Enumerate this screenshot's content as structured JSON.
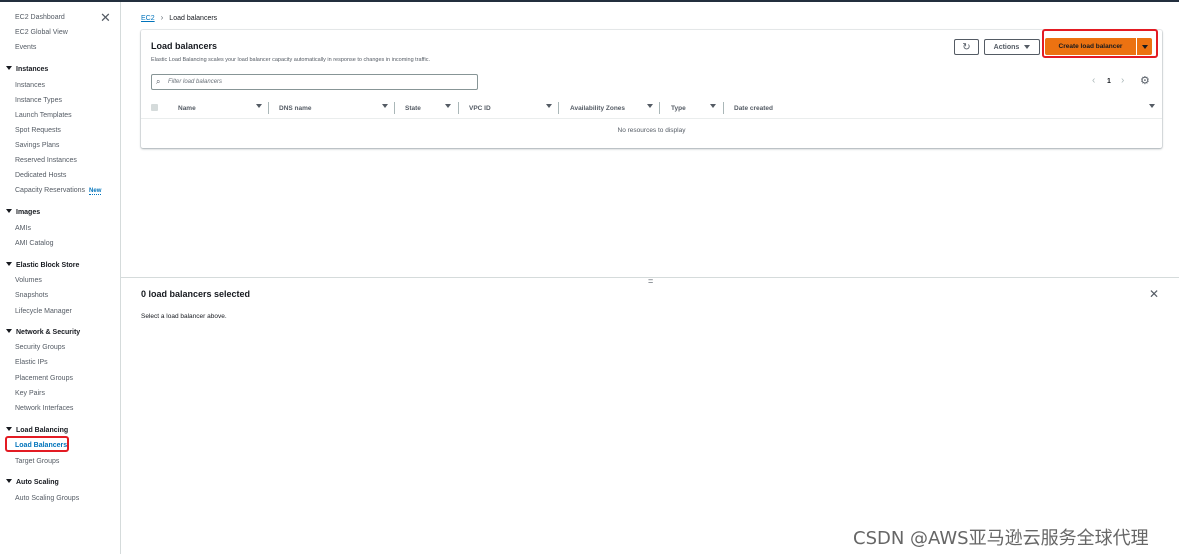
{
  "sidebar": {
    "top_items": [
      "EC2 Dashboard",
      "EC2 Global View",
      "Events"
    ],
    "sections": [
      {
        "title": "Instances",
        "items": [
          "Instances",
          "Instance Types",
          "Launch Templates",
          "Spot Requests",
          "Savings Plans",
          "Reserved Instances",
          "Dedicated Hosts",
          "Capacity Reservations"
        ]
      },
      {
        "title": "Images",
        "items": [
          "AMIs",
          "AMI Catalog"
        ]
      },
      {
        "title": "Elastic Block Store",
        "items": [
          "Volumes",
          "Snapshots",
          "Lifecycle Manager"
        ]
      },
      {
        "title": "Network & Security",
        "items": [
          "Security Groups",
          "Elastic IPs",
          "Placement Groups",
          "Key Pairs",
          "Network Interfaces"
        ]
      },
      {
        "title": "Load Balancing",
        "items": [
          "Load Balancers",
          "Target Groups"
        ]
      },
      {
        "title": "Auto Scaling",
        "items": [
          "Auto Scaling Groups"
        ]
      }
    ],
    "new_badge": "New",
    "active_item": "Load Balancers"
  },
  "breadcrumb": {
    "root": "EC2",
    "current": "Load balancers"
  },
  "panel": {
    "title": "Load balancers",
    "description": "Elastic Load Balancing scales your load balancer capacity automatically in response to changes in incoming traffic.",
    "actions_label": "Actions",
    "create_label": "Create load balancer",
    "filter_placeholder": "Filter load balancers",
    "page_number": "1",
    "columns": [
      "Name",
      "DNS name",
      "State",
      "VPC ID",
      "Availability Zones",
      "Type",
      "Date created"
    ],
    "empty_text": "No resources to display"
  },
  "details": {
    "title": "0 load balancers selected",
    "description": "Select a load balancer above."
  },
  "watermark": "CSDN @AWS亚马逊云服务全球代理",
  "colors": {
    "primary_button": "#ec7211",
    "link": "#0073bb",
    "highlight": "#e31b23"
  }
}
